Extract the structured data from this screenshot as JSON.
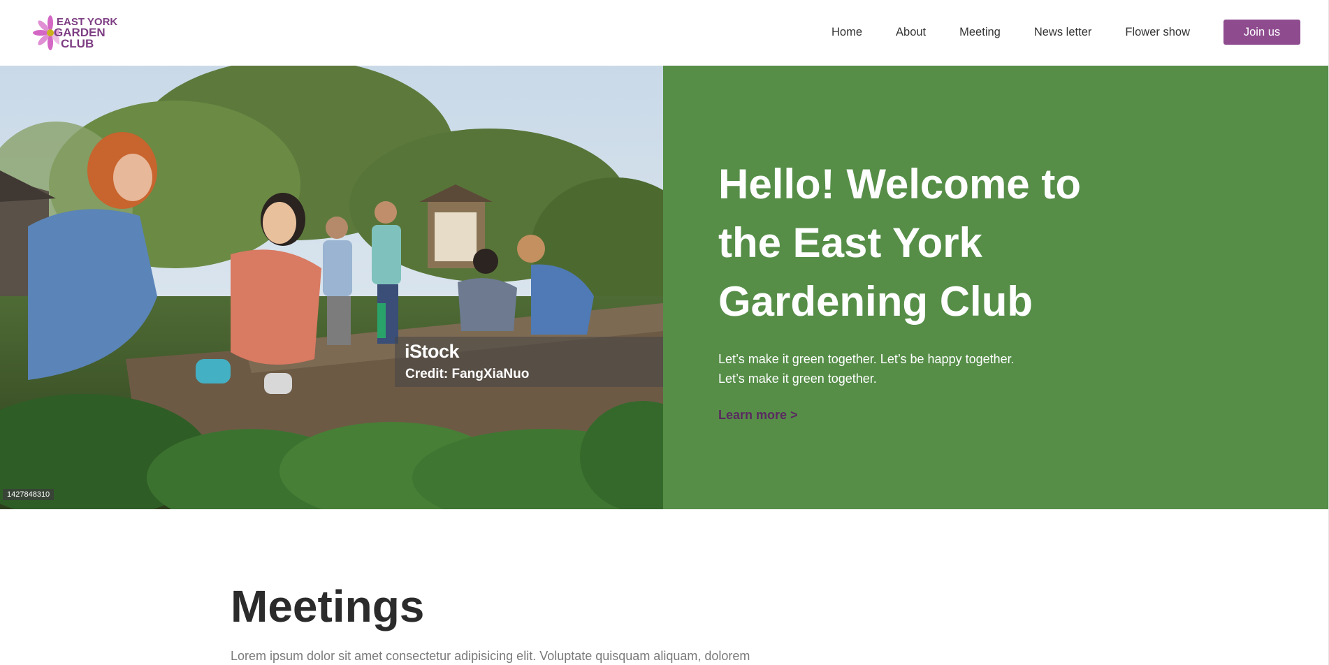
{
  "brand": {
    "line1": "EAST YORK",
    "line2": "GARDEN",
    "line3": "CLUB",
    "text_color": "#7d3d83",
    "flower_color": "#d467c4"
  },
  "nav": {
    "items": [
      {
        "label": "Home"
      },
      {
        "label": "About"
      },
      {
        "label": "Meeting"
      },
      {
        "label": "News letter"
      },
      {
        "label": "Flower show"
      }
    ],
    "join_label": "Join us",
    "join_color": "#8e4c8f"
  },
  "hero": {
    "title": "Hello! Welcome to the East York Gardening Club",
    "text_line1": "Let’s make it green together. Let’s be happy together.",
    "text_line2": "Let’s make it green together.",
    "link_label": "Learn more >",
    "bg_color": "#568e48",
    "photo": {
      "watermark": "iStock",
      "credit": "Credit: FangXiaNuo",
      "image_id": "1427848310"
    }
  },
  "meetings": {
    "title": "Meetings",
    "text": "Lorem ipsum dolor sit amet consectetur adipisicing elit. Voluptate quisquam aliquam, dolorem"
  }
}
